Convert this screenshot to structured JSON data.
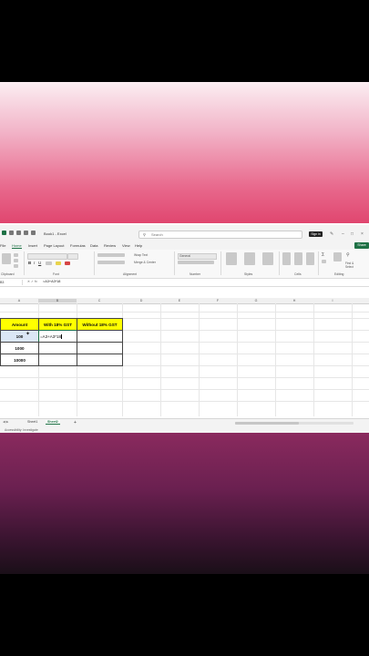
{
  "titlebar": {
    "title": "Book1 - Excel",
    "search_placeholder": "Search",
    "signin_label": "Sign in"
  },
  "tabs": [
    "File",
    "Home",
    "Insert",
    "Page Layout",
    "Formulas",
    "Data",
    "Review",
    "View",
    "Help"
  ],
  "active_tab": "Home",
  "share_label": "Share",
  "ribbon_groups": [
    "Clipboard",
    "Font",
    "Alignment",
    "Number",
    "Styles",
    "Cells",
    "Editing"
  ],
  "ribbon": {
    "wrap_text": "Wrap Text",
    "merge_center": "Merge & Center",
    "general": "General",
    "find_select": "Find & Select"
  },
  "name_box": "B3",
  "formula": "=A3+A3*18",
  "columns": [
    "A",
    "B",
    "C",
    "D",
    "E",
    "F",
    "G",
    "H",
    "I"
  ],
  "table": {
    "headers": [
      "Amount",
      "With 18% GST",
      "Without 18% GST"
    ],
    "rows": [
      {
        "amount": "100",
        "with_gst": "=A3+A3*18",
        "without_gst": ""
      },
      {
        "amount": "1000",
        "with_gst": "",
        "without_gst": ""
      },
      {
        "amount": "10000",
        "with_gst": "",
        "without_gst": ""
      }
    ]
  },
  "sheets": [
    "Sheet1",
    "Sheet2"
  ],
  "active_sheet": "Sheet2",
  "status": "Accessibility: Investigate",
  "colors": {
    "excel_green": "#1e7145",
    "header_yellow": "#ffff00",
    "selected_cell": "#dbe6f5",
    "gradient_pink": "#e0466f",
    "gradient_plum": "#6a2050"
  }
}
